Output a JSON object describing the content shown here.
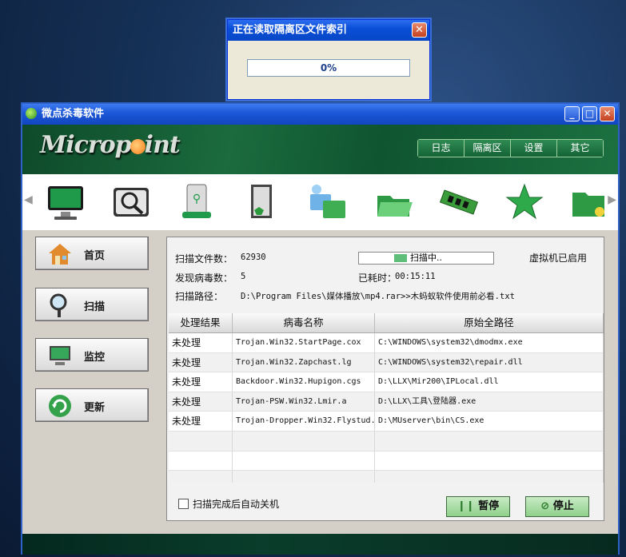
{
  "progress_dialog": {
    "title": "正在读取隔离区文件索引",
    "percent_text": "0%",
    "close_symbol": "✕"
  },
  "window": {
    "title": "微点杀毒软件",
    "min_symbol": "_",
    "max_symbol": "□",
    "close_symbol": "✕"
  },
  "logo": {
    "text_before": "Microp",
    "text_after": "int"
  },
  "top_nav": [
    "日志",
    "隔离区",
    "设置",
    "其它"
  ],
  "toolbar_icons": [
    "monitor-icon",
    "search-drive-icon",
    "usb-drive-icon",
    "door-exit-icon",
    "network-folder-icon",
    "open-folder-icon",
    "memory-chip-icon",
    "star-icon",
    "star-folder-icon"
  ],
  "sidebar": [
    {
      "label": "首页",
      "icon": "home-icon"
    },
    {
      "label": "扫描",
      "icon": "magnifier-icon"
    },
    {
      "label": "监控",
      "icon": "monitor-icon"
    },
    {
      "label": "更新",
      "icon": "refresh-icon"
    }
  ],
  "scan": {
    "files_label": "扫描文件数：",
    "files_value": "62930",
    "status_text": "扫描中..",
    "vm_text": "虚拟机已启用",
    "virus_label": "发现病毒数：",
    "virus_value": "5",
    "elapsed_label": "已耗时：",
    "elapsed_value": "00:15:11",
    "path_label": "扫描路径：",
    "path_value": "D:\\Program Files\\媒体播放\\mp4.rar>>木蚂蚁软件使用前必看.txt"
  },
  "table": {
    "headers": [
      "处理结果",
      "病毒名称",
      "原始全路径"
    ],
    "rows": [
      [
        "未处理",
        "Trojan.Win32.StartPage.cox",
        "C:\\WINDOWS\\system32\\dmodmx.exe"
      ],
      [
        "未处理",
        "Trojan.Win32.Zapchast.lg",
        "C:\\WINDOWS\\system32\\repair.dll"
      ],
      [
        "未处理",
        "Backdoor.Win32.Hupigon.cgs",
        "D:\\LLX\\Mir200\\IPLocal.dll"
      ],
      [
        "未处理",
        "Trojan-PSW.Win32.Lmir.a",
        "D:\\LLX\\工具\\登陆器.exe"
      ],
      [
        "未处理",
        "Trojan-Dropper.Win32.Flystud.",
        "D:\\MUserver\\bin\\CS.exe"
      ],
      [
        "",
        "",
        ""
      ],
      [
        "",
        "",
        ""
      ],
      [
        "",
        "",
        ""
      ]
    ]
  },
  "auto_shutdown_label": "扫描完成后自动关机",
  "pause_label": "暂停",
  "stop_label": "停止"
}
